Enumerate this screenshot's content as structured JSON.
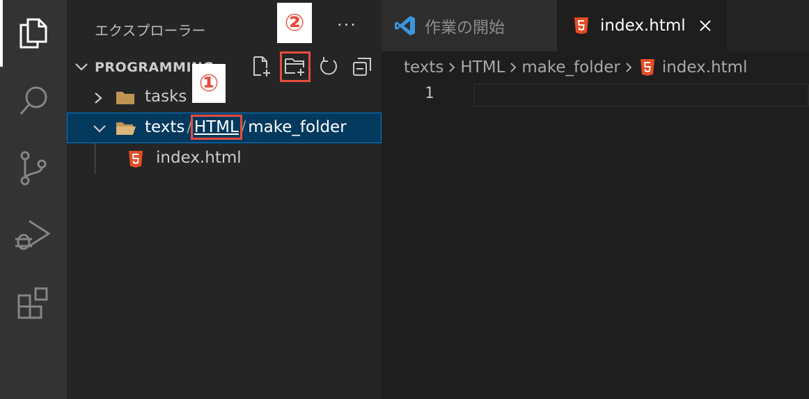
{
  "sidebar": {
    "title": "エクスプローラー",
    "more": "···",
    "section_title": "PROGRAMMING",
    "actions": [
      "new-file",
      "new-folder",
      "refresh",
      "collapse-all"
    ]
  },
  "tree": {
    "tasks_label": "tasks",
    "compact_folder": {
      "segments": [
        "texts",
        "HTML",
        "make_folder"
      ],
      "separator": "/"
    },
    "file_label": "index.html"
  },
  "badges": {
    "one": "①",
    "two": "②"
  },
  "tabs": [
    {
      "label": "作業の開始",
      "active": false
    },
    {
      "label": "index.html",
      "active": true
    }
  ],
  "breadcrumbs": [
    "texts",
    "HTML",
    "make_folder",
    "index.html"
  ],
  "editor": {
    "line_number": "1"
  },
  "colors": {
    "highlight": "#e74c3c",
    "selection": "#04395e",
    "html5": "#e44d26",
    "vscode_blue": "#3a96dd"
  }
}
